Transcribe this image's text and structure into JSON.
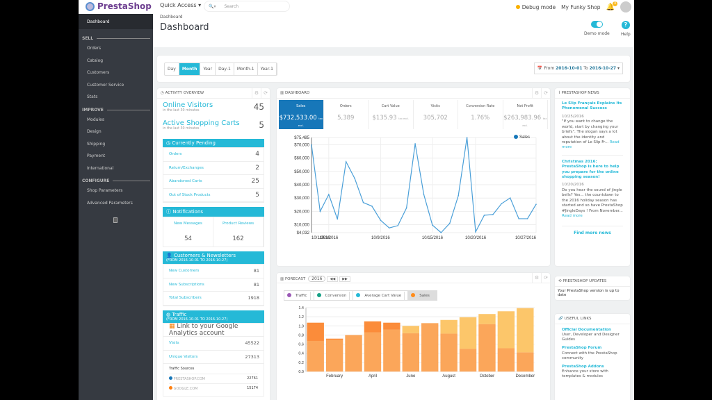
{
  "topbar": {
    "logo": "PrestaShop",
    "quick_access": "Quick Access ▾",
    "search_dropdown": "🔍▾",
    "search_placeholder": "Search",
    "debug": "Debug mode",
    "shop": "My Funky Shop",
    "notif_count": "3",
    "debug_color": "#fab000"
  },
  "sidebar": {
    "dashboard": "Dashboard",
    "sections": [
      {
        "title": "SELL",
        "items": [
          "Orders",
          "Catalog",
          "Customers",
          "Customer Service",
          "Stats"
        ]
      },
      {
        "title": "IMPROVE",
        "items": [
          "Modules",
          "Design",
          "Shipping",
          "Payment",
          "International"
        ]
      },
      {
        "title": "CONFIGURE",
        "items": [
          "Shop Parameters",
          "Advanced Parameters"
        ]
      }
    ]
  },
  "header": {
    "breadcrumb": "Dashboard",
    "title": "Dashboard",
    "demo_mode": "Demo mode",
    "demo_mode_on": true,
    "help": "Help"
  },
  "filter": {
    "buttons": [
      "Day",
      "Month",
      "Year",
      "Day-1",
      "Month-1",
      "Year-1"
    ],
    "active": "Month",
    "from_label": "From",
    "from": "2016-10-01",
    "to_label": "To",
    "to": "2016-10-27"
  },
  "activity": {
    "title": "ACTIVITY OVERVIEW",
    "online_visitors": "Online Visitors",
    "online_visitors_sub": "in the last 30 minutes",
    "online_visitors_val": "45",
    "carts": "Active Shopping Carts",
    "carts_sub": "in the last 30 minutes",
    "carts_val": "5",
    "pending_title": "Currently Pending",
    "pending": [
      {
        "label": "Orders",
        "value": "4"
      },
      {
        "label": "Return/Exchanges",
        "value": "2"
      },
      {
        "label": "Abandoned Carts",
        "value": "25"
      },
      {
        "label": "Out of Stock Products",
        "value": "5"
      }
    ],
    "notifications_title": "Notifications",
    "new_messages": "New Messages",
    "new_messages_val": "54",
    "product_reviews": "Product Reviews",
    "product_reviews_val": "162",
    "customers_title": "Customers & Newsletters",
    "customers_range": "(FROM 2016-10-01 TO 2016-10-27)",
    "customers": [
      {
        "label": "New Customers",
        "value": "81"
      },
      {
        "label": "New Subscriptions",
        "value": "81"
      },
      {
        "label": "Total Subscribers",
        "value": "1918"
      }
    ],
    "traffic_title": "Traffic",
    "traffic_range": "(FROM 2016-10-01 TO 2016-10-27)",
    "ga_link": "Link to your Google Analytics account",
    "traffic": [
      {
        "label": "Visits",
        "value": "45522"
      },
      {
        "label": "Unique Visitors",
        "value": "27313"
      }
    ],
    "sources_title": "Traffic Sources",
    "sources": [
      {
        "label": "PRESTASHOP.COM",
        "value": "22761",
        "color": "#1777b9"
      },
      {
        "label": "GOOGLE.COM",
        "value": "15174",
        "color": "#ff7f0e"
      }
    ]
  },
  "dashboard": {
    "title": "DASHBOARD",
    "kpis": [
      {
        "label": "Sales",
        "value": "$732,533.00",
        "suffix": "tax excl."
      },
      {
        "label": "Orders",
        "value": "5,389",
        "suffix": ""
      },
      {
        "label": "Cart Value",
        "value": "$135.93",
        "suffix": "tax excl."
      },
      {
        "label": "Visits",
        "value": "305,702",
        "suffix": ""
      },
      {
        "label": "Conversion Rate",
        "value": "1.76%",
        "suffix": ""
      },
      {
        "label": "Net Profit",
        "value": "$263,983.96",
        "suffix": "tax excl."
      }
    ]
  },
  "forecast": {
    "title": "FORECAST",
    "year": "2016",
    "prev": "◀◀",
    "next": "▶▶",
    "legend": [
      {
        "label": "Traffic",
        "color": "#9b59b6"
      },
      {
        "label": "Conversion",
        "color": "#16a085"
      },
      {
        "label": "Average Cart Value",
        "color": "#25b9d7"
      },
      {
        "label": "Sales",
        "color": "#ff8c1a",
        "active": true
      }
    ]
  },
  "chart_data": [
    {
      "type": "line",
      "legend": [
        "Sales"
      ],
      "series": [
        {
          "name": "Sales",
          "color": "#4a9fd8",
          "x": [
            "10/1/2016",
            "10/2/2016",
            "10/3/2016",
            "10/4/2016",
            "10/5/2016",
            "10/6/2016",
            "10/7/2016",
            "10/8/2016",
            "10/9/2016",
            "10/10/2016",
            "10/11/2016",
            "10/12/2016",
            "10/13/2016",
            "10/14/2016",
            "10/15/2016",
            "10/16/2016",
            "10/17/2016",
            "10/18/2016",
            "10/19/2016",
            "10/20/2016",
            "10/21/2016",
            "10/22/2016",
            "10/23/2016",
            "10/24/2016",
            "10/25/2016",
            "10/26/2016",
            "10/27/2016"
          ],
          "values": [
            70000,
            20000,
            32700,
            14200,
            57300,
            44800,
            26600,
            23900,
            13300,
            7600,
            9300,
            22600,
            70800,
            32700,
            9700,
            4032,
            11000,
            31800,
            75485,
            4600,
            17100,
            17600,
            25800,
            30100,
            14500,
            14500,
            25300
          ]
        }
      ],
      "ylim": [
        4032,
        75485
      ],
      "yticks": [
        "$75,485",
        "$70,000",
        "$60,000",
        "$50,000",
        "$40,000",
        "$30,000",
        "$20,000",
        "$10,000",
        "$4,032"
      ],
      "ytick_values": [
        75485,
        70000,
        60000,
        50000,
        40000,
        30000,
        20000,
        10000,
        4032
      ],
      "xticks": [
        "10/1/2016",
        "10/3/2016",
        "10/9/2016",
        "10/15/2016",
        "10/20/2016",
        "10/27/2016"
      ],
      "legend_position": "top-right",
      "grid": true
    },
    {
      "type": "bar",
      "stacked": true,
      "categories": [
        "January",
        "February",
        "March",
        "April",
        "May",
        "June",
        "July",
        "August",
        "September",
        "October",
        "November",
        "December"
      ],
      "xticks": [
        "February",
        "April",
        "June",
        "August",
        "October",
        "December"
      ],
      "ylim": [
        0,
        1.4
      ],
      "yticks": [
        "0.0",
        "0.2",
        "0.4",
        "0.6",
        "0.8",
        "1.0",
        "1.2",
        "1.4"
      ],
      "series": [
        {
          "values": [
            0.67,
            0.7,
            0.8,
            0.86,
            0.92,
            0.84,
            1.06,
            0.83,
            0.5,
            1.04,
            0.51,
            0.42
          ],
          "color": "#fba65a"
        },
        {
          "values": [
            0.4,
            0.02,
            0,
            0.24,
            0.15,
            0.16,
            0,
            0.3,
            0.69,
            0.22,
            0.81,
            0.97
          ],
          "colors": [
            "#fb8c3a",
            "#fb8c3a",
            "#fb8c3a",
            "#fb8c3a",
            "#fb8c3a",
            "#fcc66a",
            "#fcc66a",
            "#fcc66a",
            "#fcc66a",
            "#fcc66a",
            "#fcc66a",
            "#fcc66a"
          ]
        }
      ],
      "grid": true
    }
  ],
  "news": {
    "title": "PRESTASHOP NEWS",
    "items": [
      {
        "title": "Le Slip Français Explains Its Phenomenal Success",
        "date": "10/25/2016",
        "text": "\"If you want to change the world, start by changing your briefs\". The slogan says a lot about the identity and reputation of Le Slip Fr...",
        "read_more": "Read more"
      },
      {
        "title": "Christmas 2016: PrestaShop is here to help you prepare for the online shopping season!",
        "date": "10/20/2016",
        "text": "Do you hear the sound of jingle bells? Yes... the countdown to the 2016 holiday season has started and so have PrestaShop #JingleDays ! From November...",
        "read_more": "Read more"
      }
    ],
    "find_more": "Find more news"
  },
  "updates": {
    "title": "PRESTASHOP UPDATES",
    "text": "Your PrestaShop version is up to date"
  },
  "links": {
    "title": "USEFUL LINKS",
    "items": [
      {
        "title": "Official Documentation",
        "text": "User, Developer and Designer Guides"
      },
      {
        "title": "PrestaShop Forum",
        "text": "Connect with the PrestaShop community"
      },
      {
        "title": "PrestaShop Addons",
        "text": "Enhance your store with templates & modules"
      }
    ]
  }
}
